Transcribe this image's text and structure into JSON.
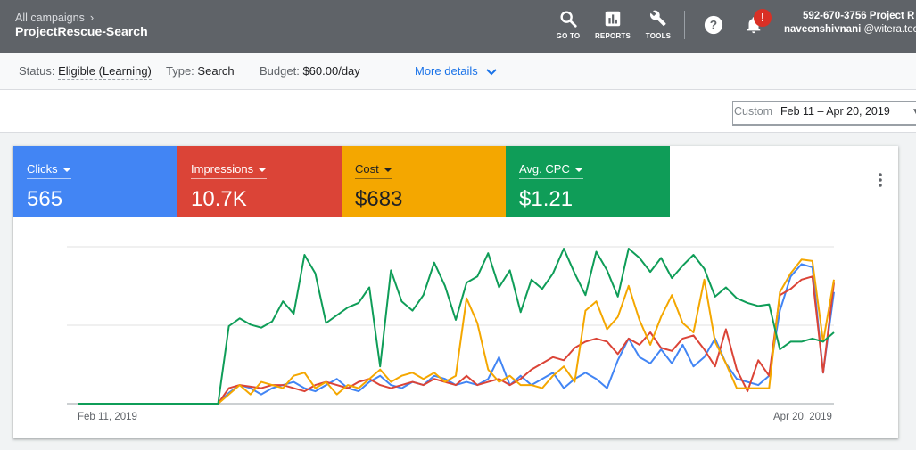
{
  "header": {
    "breadcrumb": "All campaigns",
    "campaign_name": "ProjectRescue-Search",
    "tools": [
      {
        "label": "GO TO",
        "icon": "search-icon"
      },
      {
        "label": "REPORTS",
        "icon": "reports-icon"
      },
      {
        "label": "TOOLS",
        "icon": "wrench-icon"
      }
    ],
    "notification_badge": "!",
    "account_id": "592-670-3756 Project R",
    "account_user": "naveenshivnani",
    "account_email": "@witera.tec"
  },
  "status_bar": {
    "status_label": "Status:",
    "status_value": "Eligible (Learning)",
    "type_label": "Type:",
    "type_value": "Search",
    "budget_label": "Budget:",
    "budget_value": "$60.00/day",
    "more_details": "More details"
  },
  "date_range": {
    "preset": "Custom",
    "range": "Feb 11 – Apr 20, 2019"
  },
  "metrics": [
    {
      "label": "Clicks",
      "value": "565",
      "color": "#4285f4"
    },
    {
      "label": "Impressions",
      "value": "10.7K",
      "color": "#db4437"
    },
    {
      "label": "Cost",
      "value": "$683",
      "color": "#f4a700"
    },
    {
      "label": "Avg. CPC",
      "value": "$1.21",
      "color": "#0f9d58"
    }
  ],
  "chart_data": {
    "type": "line",
    "x_start_label": "Feb 11, 2019",
    "x_end_label": "Apr 20, 2019",
    "grid": true,
    "y_scale": "independent per series, no axis labels shown",
    "series": [
      {
        "name": "Clicks",
        "color": "#4285f4",
        "values": [
          0,
          0,
          0,
          0,
          0,
          0,
          0,
          0,
          0,
          0,
          0,
          0,
          0,
          0,
          0.07,
          0.12,
          0.1,
          0.06,
          0.1,
          0.12,
          0.14,
          0.1,
          0.08,
          0.12,
          0.16,
          0.1,
          0.08,
          0.14,
          0.18,
          0.12,
          0.1,
          0.14,
          0.12,
          0.18,
          0.16,
          0.12,
          0.14,
          0.12,
          0.16,
          0.3,
          0.12,
          0.18,
          0.12,
          0.16,
          0.2,
          0.1,
          0.16,
          0.2,
          0.16,
          0.1,
          0.28,
          0.42,
          0.3,
          0.26,
          0.35,
          0.26,
          0.38,
          0.24,
          0.3,
          0.42,
          0.26,
          0.16,
          0.14,
          0.12,
          0.18,
          0.6,
          0.82,
          0.9,
          0.88,
          0.2,
          0.72
        ]
      },
      {
        "name": "Impressions",
        "color": "#db4437",
        "values": [
          0,
          0,
          0,
          0,
          0,
          0,
          0,
          0,
          0,
          0,
          0,
          0,
          0,
          0,
          0.1,
          0.12,
          0.11,
          0.1,
          0.12,
          0.12,
          0.1,
          0.08,
          0.12,
          0.14,
          0.12,
          0.1,
          0.14,
          0.16,
          0.12,
          0.1,
          0.12,
          0.14,
          0.12,
          0.16,
          0.14,
          0.12,
          0.18,
          0.12,
          0.14,
          0.16,
          0.12,
          0.16,
          0.22,
          0.26,
          0.3,
          0.28,
          0.36,
          0.4,
          0.42,
          0.4,
          0.32,
          0.42,
          0.38,
          0.46,
          0.36,
          0.34,
          0.42,
          0.44,
          0.35,
          0.24,
          0.48,
          0.22,
          0.08,
          0.28,
          0.18,
          0.7,
          0.74,
          0.8,
          0.82,
          0.2,
          0.78
        ]
      },
      {
        "name": "Cost",
        "color": "#f4a700",
        "values": [
          0,
          0,
          0,
          0,
          0,
          0,
          0,
          0,
          0,
          0,
          0,
          0,
          0,
          0,
          0.06,
          0.12,
          0.06,
          0.14,
          0.12,
          0.1,
          0.18,
          0.2,
          0.1,
          0.14,
          0.06,
          0.12,
          0.1,
          0.16,
          0.22,
          0.14,
          0.18,
          0.2,
          0.16,
          0.2,
          0.14,
          0.18,
          0.68,
          0.52,
          0.22,
          0.14,
          0.18,
          0.12,
          0.12,
          0.1,
          0.18,
          0.24,
          0.14,
          0.6,
          0.66,
          0.48,
          0.56,
          0.76,
          0.54,
          0.38,
          0.56,
          0.7,
          0.52,
          0.46,
          0.8,
          0.4,
          0.26,
          0.1,
          0.1,
          0.1,
          0.1,
          0.72,
          0.84,
          0.93,
          0.92,
          0.4,
          0.8
        ]
      },
      {
        "name": "Avg. CPC",
        "color": "#0f9d58",
        "values": [
          0,
          0,
          0,
          0,
          0,
          0,
          0,
          0,
          0,
          0,
          0,
          0,
          0,
          0,
          0.5,
          0.55,
          0.51,
          0.49,
          0.53,
          0.66,
          0.58,
          0.96,
          0.84,
          0.52,
          0.57,
          0.62,
          0.65,
          0.75,
          0.24,
          0.86,
          0.66,
          0.6,
          0.7,
          0.91,
          0.76,
          0.54,
          0.78,
          0.82,
          0.97,
          0.75,
          0.86,
          0.59,
          0.8,
          0.74,
          0.84,
          1.0,
          0.84,
          0.7,
          0.98,
          0.86,
          0.69,
          1.0,
          0.94,
          0.85,
          0.94,
          0.81,
          0.89,
          0.96,
          0.87,
          0.69,
          0.75,
          0.68,
          0.65,
          0.63,
          0.64,
          0.35,
          0.4,
          0.4,
          0.42,
          0.4,
          0.46
        ]
      }
    ]
  }
}
